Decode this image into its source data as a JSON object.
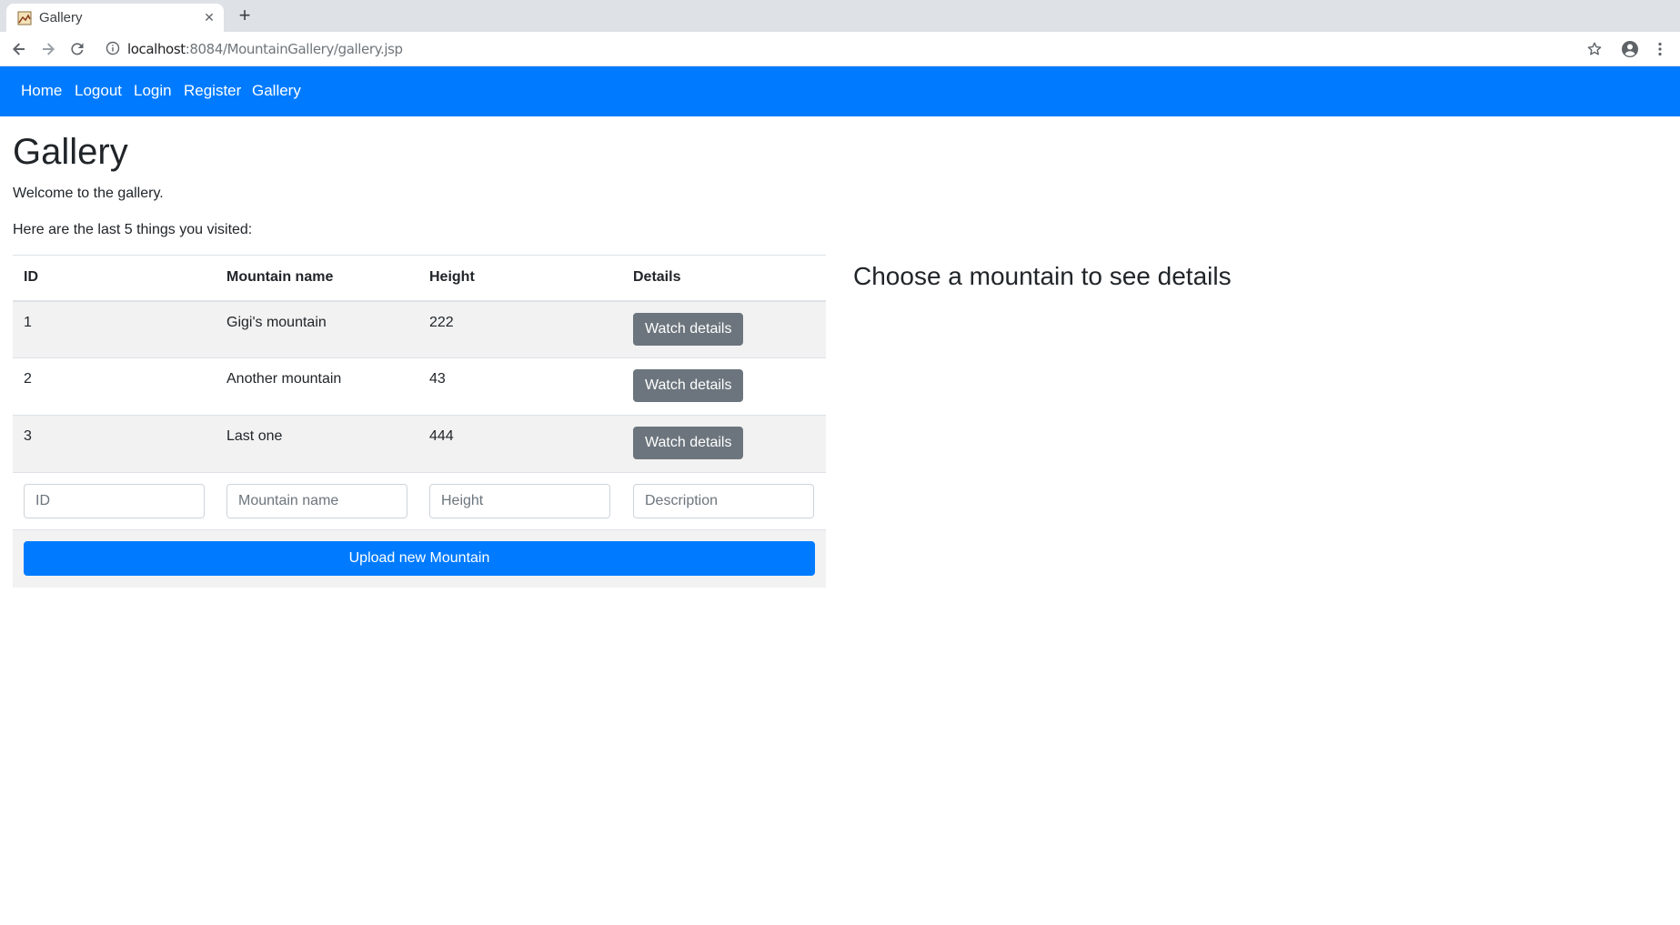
{
  "browser": {
    "tab_title": "Gallery",
    "tab_close": "✕",
    "new_tab": "+",
    "url_host": "localhost",
    "url_rest": ":8084/MountainGallery/gallery.jsp",
    "icons": [
      "back-icon",
      "forward-icon",
      "reload-icon",
      "info-icon",
      "star-icon",
      "account-icon",
      "menu-icon"
    ]
  },
  "navbar": {
    "home": "Home",
    "logout": "Logout",
    "login": "Login",
    "register": "Register",
    "gallery": "Gallery",
    "background": "#007bff"
  },
  "page": {
    "title": "Gallery",
    "welcome": "Welcome to the gallery.",
    "visited": "Here are the last 5 things you visited:",
    "details_prompt": "Choose a mountain to see details"
  },
  "table": {
    "headers": [
      "ID",
      "Mountain name",
      "Height",
      "Details"
    ],
    "rows": [
      {
        "id": "1",
        "name": "Gigi's mountain",
        "height": "222",
        "action": "Watch details"
      },
      {
        "id": "2",
        "name": "Another mountain",
        "height": "43",
        "action": "Watch details"
      },
      {
        "id": "3",
        "name": "Last one",
        "height": "444",
        "action": "Watch details"
      }
    ],
    "inputs": {
      "id_placeholder": "ID",
      "name_placeholder": "Mountain name",
      "height_placeholder": "Height",
      "description_placeholder": "Description"
    },
    "upload_label": "Upload new Mountain"
  },
  "colors": {
    "primary": "#007bff",
    "secondary_button": "#6c757d",
    "stripe": "#f2f2f2"
  }
}
